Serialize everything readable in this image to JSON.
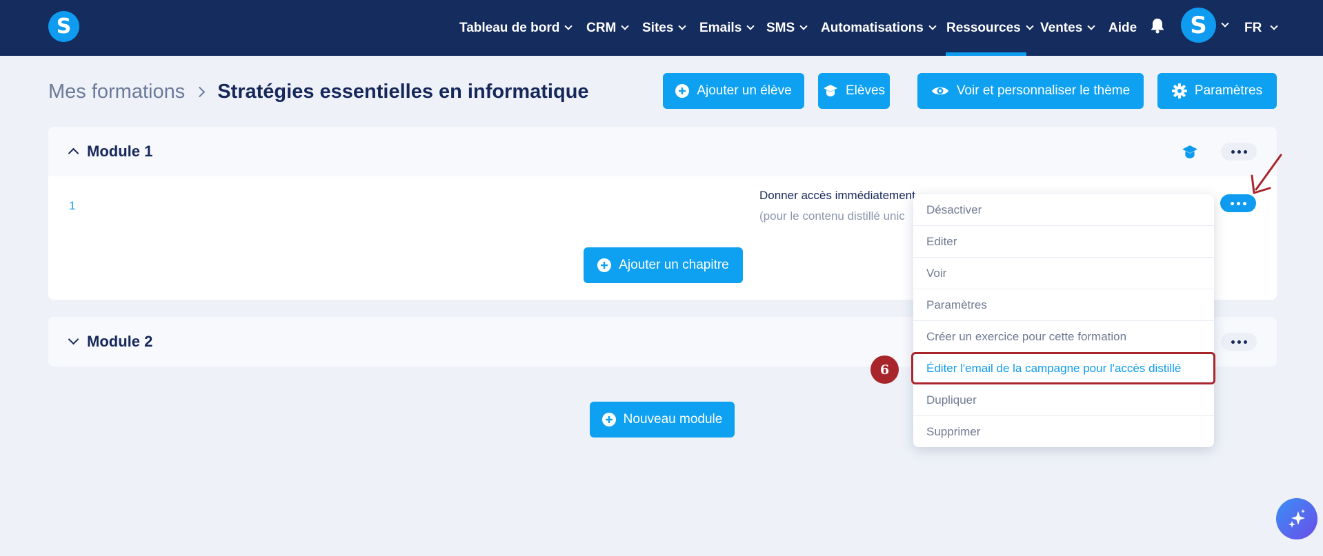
{
  "nav": {
    "logo": "S",
    "items": [
      {
        "label": "Tableau de bord"
      },
      {
        "label": "CRM"
      },
      {
        "label": "Sites"
      },
      {
        "label": "Emails"
      },
      {
        "label": "SMS"
      },
      {
        "label": "Automatisations"
      },
      {
        "label": "Ressources"
      },
      {
        "label": "Ventes"
      },
      {
        "label": "Aide"
      }
    ],
    "avatar": "S",
    "language": "FR"
  },
  "header": {
    "breadcrumb_parent": "Mes formations",
    "title": "Stratégies essentielles en informatique",
    "buttons": {
      "add_student": "Ajouter un élève",
      "students": "Elèves",
      "theme": "Voir et personnaliser le thème",
      "settings": "Paramètres"
    }
  },
  "modules": [
    {
      "title": "Module 1",
      "chapter": {
        "number": "1",
        "access_text": "Donner accès immédiatement",
        "access_sub": "(pour le contenu distillé unic"
      },
      "add_chapter": "Ajouter un chapitre"
    },
    {
      "title": "Module 2"
    }
  ],
  "new_module": "Nouveau module",
  "dropdown": {
    "items": [
      {
        "label": "Désactiver"
      },
      {
        "label": "Editer"
      },
      {
        "label": "Voir"
      },
      {
        "label": "Paramètres"
      },
      {
        "label": "Créer un exercice pour cette formation"
      },
      {
        "label": "Éditer l'email de la campagne pour l'accès distillé"
      },
      {
        "label": "Dupliquer"
      },
      {
        "label": "Supprimer"
      }
    ]
  },
  "annotation": {
    "step": "6"
  },
  "colors": {
    "navbar": "#152c5e",
    "accent": "#0ea1f2",
    "annotation": "#a8262b"
  }
}
